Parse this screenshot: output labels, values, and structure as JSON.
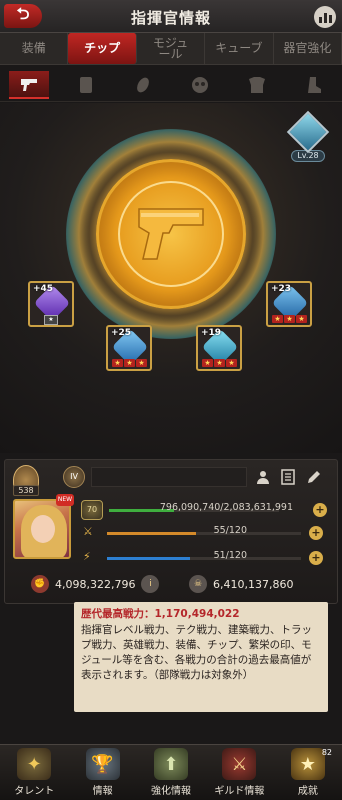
{
  "header": {
    "title": "指揮官情報",
    "back_icon": "back-arrow-icon",
    "stats_icon": "bar-chart-icon"
  },
  "tabs": [
    {
      "label": "装備",
      "active": false
    },
    {
      "label": "チップ",
      "active": true
    },
    {
      "label": "モジュ\nール",
      "active": false
    },
    {
      "label": "キューブ",
      "active": false
    },
    {
      "label": "器官強化",
      "active": false
    }
  ],
  "subtabs": [
    "pistol-icon",
    "card-icon",
    "grenade-icon",
    "mask-icon",
    "armor-icon",
    "boot-icon"
  ],
  "main": {
    "center_icon": "pistol-icon",
    "level_label": "Lv.28",
    "chips": [
      {
        "plus": "+45",
        "color": "purple"
      },
      {
        "plus": "+23",
        "color": "blue"
      },
      {
        "plus": "+25",
        "color": "blue"
      },
      {
        "plus": "+19",
        "color": "cyan"
      }
    ]
  },
  "profile": {
    "rank_value": "538",
    "level_badge": "70",
    "new_badge": "NEW",
    "power_bar": {
      "value": "796,090,740/2,083,631,991",
      "fill": 0.38,
      "color": "#3fae3f"
    },
    "stamina_bar": {
      "value": "55/120",
      "fill": 0.46,
      "color": "#d48a2a"
    },
    "energy_bar": {
      "value": "51/120",
      "fill": 0.43,
      "color": "#2d7fd1"
    },
    "power_total": "4,098,322,796",
    "kills_total": "6,410,137,860"
  },
  "tooltip": {
    "title": "歴代最高戦力：1,170,494,022",
    "body": "指揮官レベル戦力、テク戦力、建築戦力、トラップ戦力、英雄戦力、装備、チップ、繁栄の印、モジュール等を含む、各戦力の合計の過去最高値が表示されます。（部隊戦力は対象外）"
  },
  "bottom_nav": [
    {
      "label": "タレント",
      "icon": "talent-icon"
    },
    {
      "label": "情報",
      "icon": "trophy-icon"
    },
    {
      "label": "強化情報",
      "icon": "upgrade-icon"
    },
    {
      "label": "ギルド情報",
      "icon": "guild-icon"
    },
    {
      "label": "成就",
      "icon": "achievement-icon",
      "count": "82"
    }
  ]
}
